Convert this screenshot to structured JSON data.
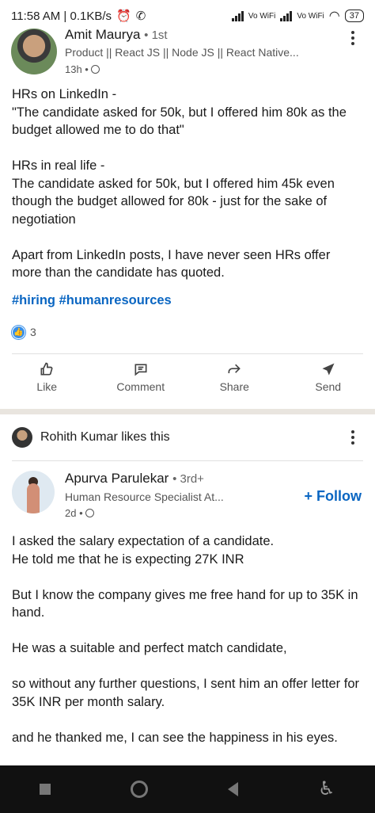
{
  "status_bar": {
    "time_speed": "11:58 AM | 0.1KB/s",
    "net_label_1": "Vo WiFi",
    "net_label_2": "Vo WiFi",
    "battery": "37"
  },
  "post1": {
    "author_name": "Amit Maurya",
    "author_degree": "• 1st",
    "author_headline": "Product || React JS || Node JS || React Native...",
    "time": "13h •",
    "body": [
      "HRs on LinkedIn  -",
      "\"The candidate asked for 50k, but I offered him 80k as the budget allowed me to do that\"",
      "",
      "HRs in real life -",
      "The candidate asked for 50k, but I offered him 45k even though the budget allowed for 80k - just for the sake of negotiation",
      "",
      "Apart from LinkedIn posts, I have never seen HRs offer more than the candidate has quoted."
    ],
    "hashtags": "#hiring #humanresources",
    "reaction_count": "3"
  },
  "actions": {
    "like": "Like",
    "comment": "Comment",
    "share": "Share",
    "send": "Send"
  },
  "post2": {
    "liker_text": "Rohith Kumar likes this",
    "author_name": "Apurva Parulekar",
    "author_degree": "• 3rd+",
    "author_headline": "Human Resource Specialist At...",
    "time": "2d •",
    "follow_label": "+ Follow",
    "body": [
      "I asked the salary expectation of a candidate.",
      "He told me that he is expecting 27K INR",
      "",
      "But I know the company gives me free hand for up to 35K in hand.",
      "",
      "He was a suitable and perfect match candidate,",
      "",
      "so without any further questions, I sent him an offer letter for 35K INR per month salary.",
      "",
      "and he thanked me, I can see the happiness in his eyes."
    ]
  },
  "colors": {
    "link_blue": "#0a66c2",
    "like_blue": "#378fe9"
  }
}
